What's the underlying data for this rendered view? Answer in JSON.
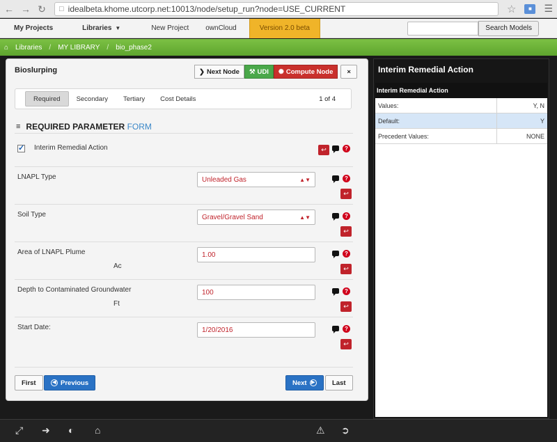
{
  "browser": {
    "url": "idealbeta.khome.utcorp.net:10013/node/setup_run?node=USE_CURRENT"
  },
  "nav": {
    "my_projects": "My Projects",
    "libraries": "Libraries",
    "new_project": "New Project",
    "owncloud": "ownCloud",
    "version": "Version 2.0 beta",
    "search_button": "Search Models",
    "search_placeholder": ""
  },
  "breadcrumb": [
    "Libraries",
    "MY LIBRARY",
    "bio_phase2"
  ],
  "panel": {
    "title": "Bioslurping",
    "next_node": "Next Node",
    "udi": "UDI",
    "compute_node": "Compute Node",
    "close": "×"
  },
  "tabs": [
    "Required",
    "Secondary",
    "Tertiary",
    "Cost Details"
  ],
  "page_indicator": "1 of 4",
  "heading": {
    "main": "REQUIRED PARAMETER",
    "suffix": "FORM"
  },
  "fields": {
    "interim": {
      "label": "Interim Remedial Action",
      "checked": true
    },
    "lnapl": {
      "label": "LNAPL Type",
      "value": "Unleaded Gas"
    },
    "soil": {
      "label": "Soil Type",
      "value": "Gravel/Gravel Sand"
    },
    "area": {
      "label": "Area of LNAPL Plume",
      "unit": "Ac",
      "value": "1.00"
    },
    "depth": {
      "label": "Depth to Contaminated Groundwater",
      "unit": "Ft",
      "value": "100"
    },
    "start": {
      "label": "Start Date:",
      "value": "1/20/2016"
    }
  },
  "pager": {
    "first": "First",
    "previous": "Previous",
    "next": "Next",
    "last": "Last"
  },
  "side": {
    "title": "Interim Remedial Action",
    "subtitle": "Interim Remedial Action",
    "rows": [
      {
        "k": "Values:",
        "v": "Y, N"
      },
      {
        "k": "Default:",
        "v": "Y"
      },
      {
        "k": "Precedent Values:",
        "v": "NONE"
      }
    ]
  },
  "colors": {
    "accent_green": "#6ab23a",
    "version_orange": "#f0b429",
    "danger_red": "#c9302c",
    "primary_blue": "#2a72c4"
  }
}
